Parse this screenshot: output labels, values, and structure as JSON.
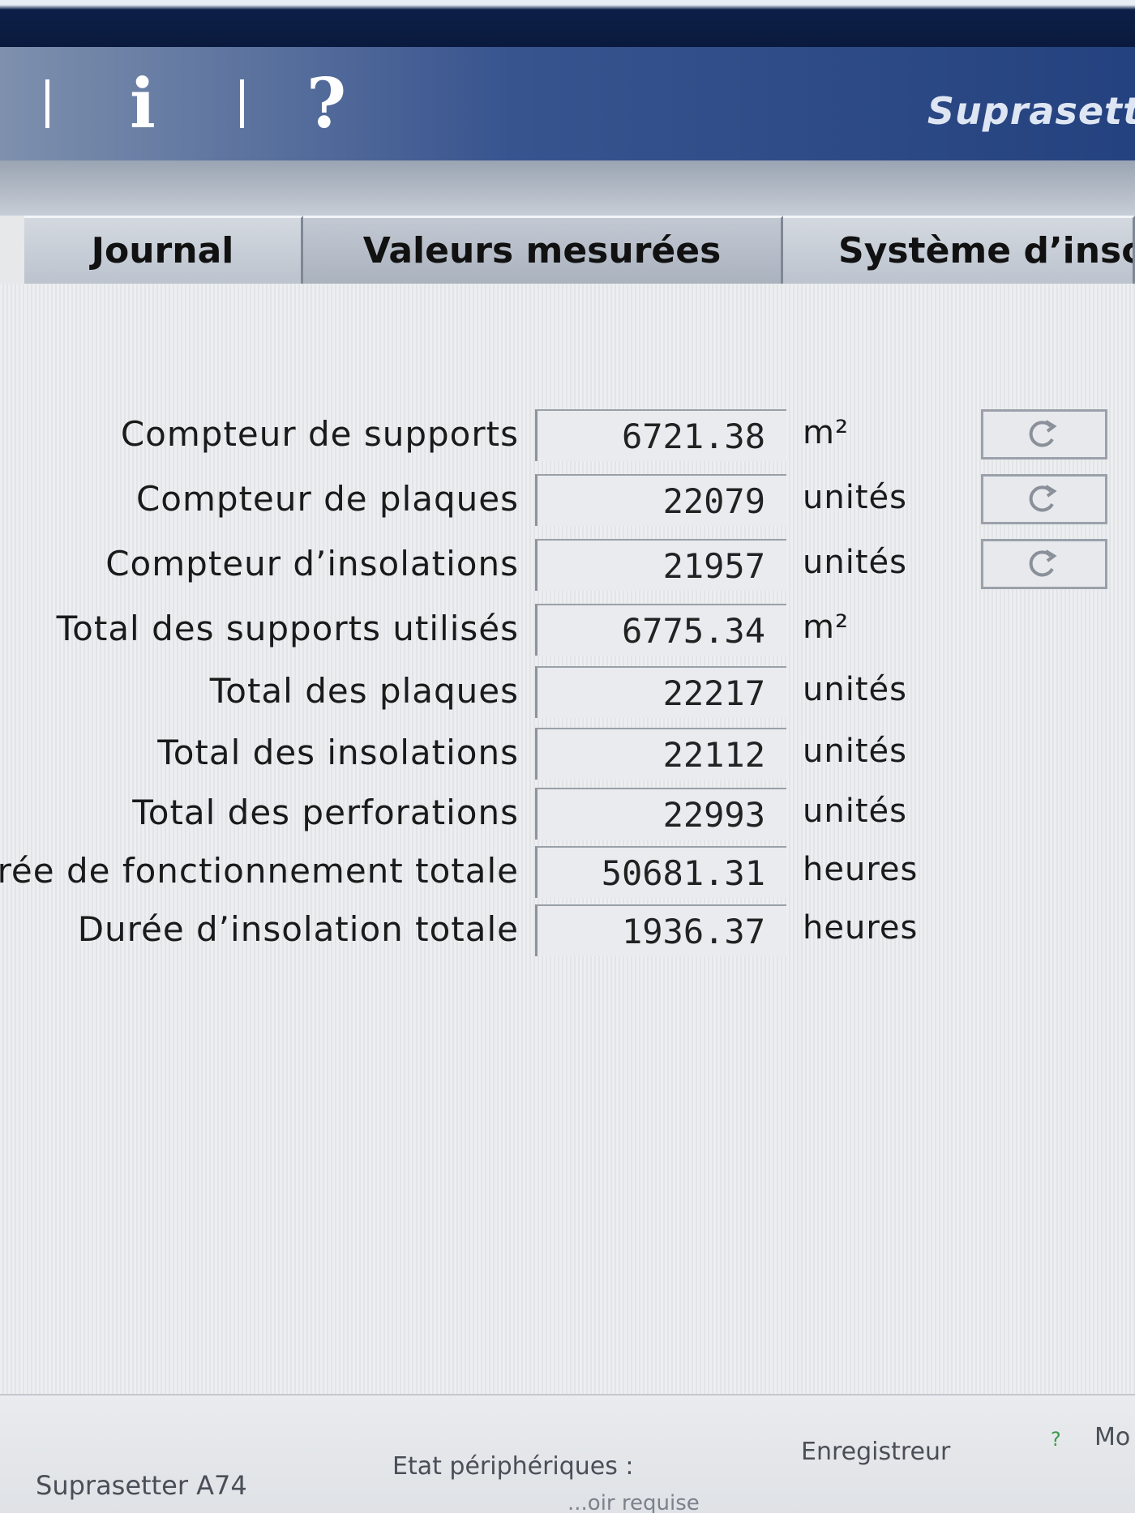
{
  "header": {
    "info_icon": "i",
    "help_icon": "?",
    "brand": "Suprasett"
  },
  "tabs": [
    {
      "label": "Journal"
    },
    {
      "label": "Valeurs mesurées"
    },
    {
      "label": "Système d’insol"
    }
  ],
  "counters": [
    {
      "label": "Compteur de supports",
      "value": "6721.38",
      "unit": "m²",
      "resettable": true
    },
    {
      "label": "Compteur de plaques",
      "value": "22079",
      "unit": "unités",
      "resettable": true
    },
    {
      "label": "Compteur d’insolations",
      "value": "21957",
      "unit": "unités",
      "resettable": true
    },
    {
      "label": "Total des supports utilisés",
      "value": "6775.34",
      "unit": "m²",
      "resettable": false
    },
    {
      "label": "Total des plaques",
      "value": "22217",
      "unit": "unités",
      "resettable": false
    },
    {
      "label": "Total des insolations",
      "value": "22112",
      "unit": "unités",
      "resettable": false
    },
    {
      "label": "Total des perforations",
      "value": "22993",
      "unit": "unités",
      "resettable": false
    },
    {
      "label": "urée de fonctionnement totale",
      "value": "50681.31",
      "unit": "heures",
      "resettable": false
    },
    {
      "label": "Durée d’insolation totale",
      "value": "1936.37",
      "unit": "heures",
      "resettable": false
    }
  ],
  "reset_icon": "refresh-icon",
  "status": {
    "device": "Suprasetter A74",
    "peripherals_label": "Etat périphériques :",
    "recorder": "Enregistreur",
    "recorder_status_icon": "?",
    "mode_cut": "Mo",
    "peripherals_state": "...oir requise"
  }
}
